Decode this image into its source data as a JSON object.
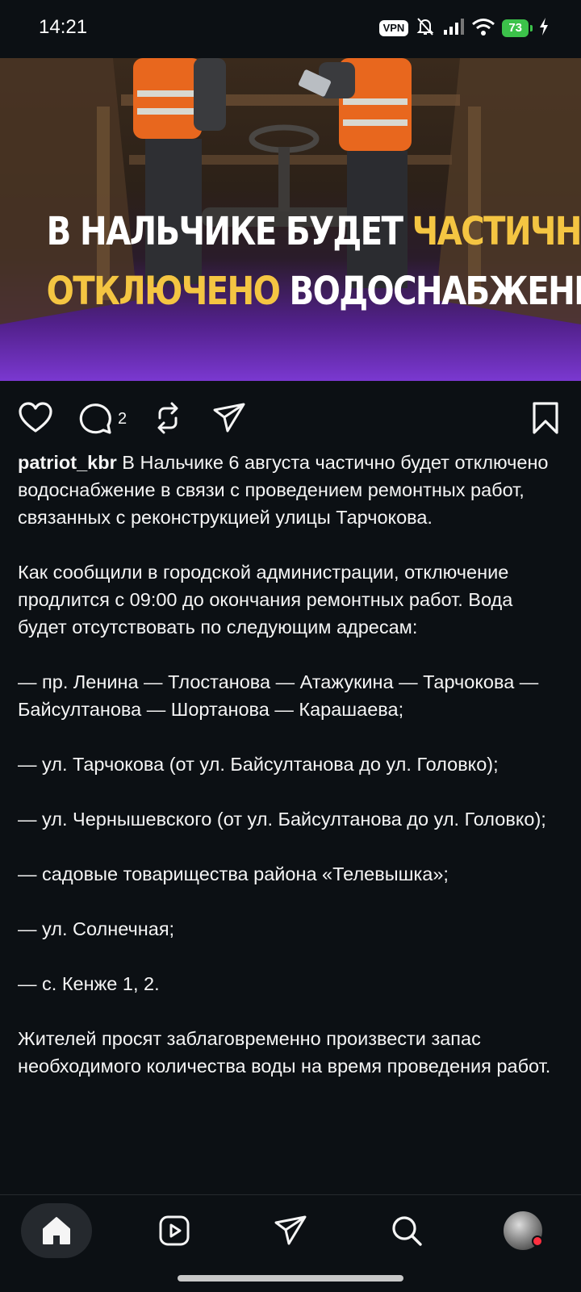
{
  "status_bar": {
    "time": "14:21",
    "vpn_label": "VPN",
    "battery_level": "73",
    "icons": [
      "vpn-icon",
      "mute-bell-icon",
      "signal-icon",
      "wifi-icon",
      "battery-icon",
      "charging-icon"
    ]
  },
  "post": {
    "headline": {
      "line1_white": "В Нальчике будет",
      "line1_yellow": "частично",
      "line2_yellow": "отключено",
      "line2_white": "водоснабжение"
    },
    "actions": {
      "comment_count": "2",
      "icons": [
        "heart-icon",
        "comment-icon",
        "repost-icon",
        "share-icon",
        "bookmark-icon"
      ]
    },
    "caption": {
      "username": "patriot_kbr",
      "text": " В Нальчике 6 августа частично будет отключено водоснабжение в связи с проведением ремонтных работ, связанных с реконструкцией улицы Тарчокова.\n\nКак сообщили в городской администрации, отключение продлится с 09:00 до окончания ремонтных работ. Вода будет отсутствовать по следующим адресам:\n\n— пр. Ленина — Тлостанова — Атажукина — Тарчокова — Байсултанова — Шортанова — Карашаева;\n\n— ул. Тарчокова (от ул. Байсултанова до ул. Головко);\n\n— ул. Чернышевского (от ул. Байсултанова до ул. Головко);\n\n— садовые товарищества района «Телевышка»;\n\n— ул. Солнечная;\n\n— с. Кенже 1, 2.\n\nЖителей просят заблаговременно произвести запас необходимого количества воды на время проведения работ."
    }
  },
  "bottom_nav": {
    "active": "home",
    "items": [
      "home-icon",
      "reels-icon",
      "direct-icon",
      "search-icon",
      "profile-avatar"
    ]
  },
  "colors": {
    "background": "#0c1014",
    "headline_yellow": "#f4c542",
    "gradient_purple": "#7a38d0",
    "battery_green": "#3cc24a"
  }
}
